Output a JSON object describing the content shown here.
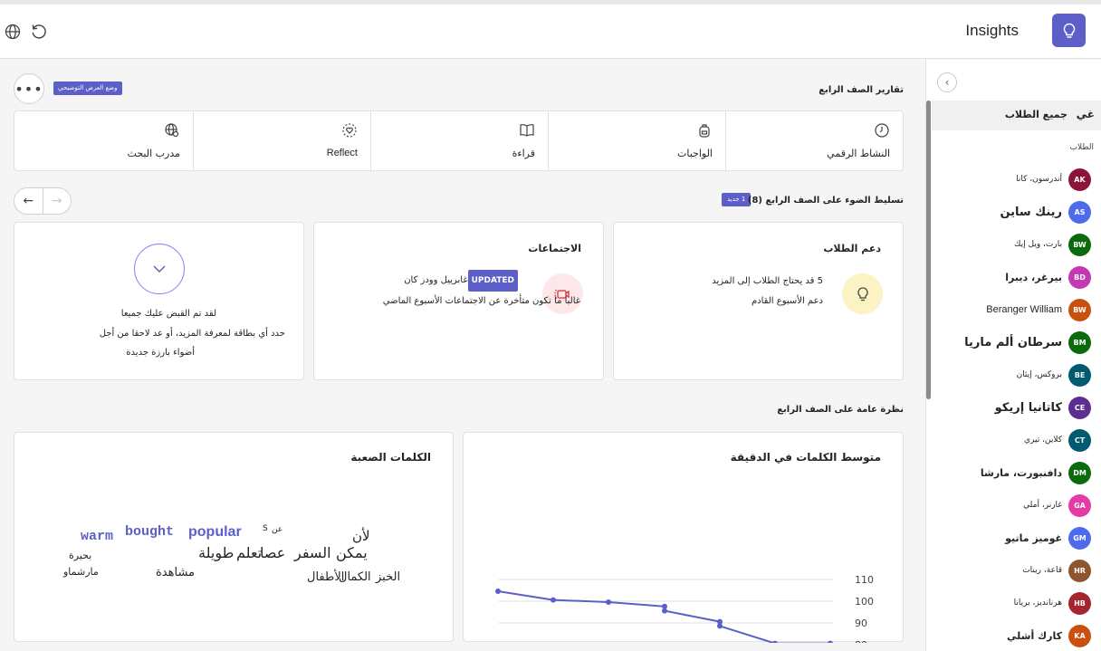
{
  "header": {
    "app_title": "Insights",
    "globe_icon": "globe-icon",
    "refresh_icon": "refresh-icon",
    "logo_icon": "lightbulb-icon"
  },
  "main": {
    "mode_badge": "وضع العرض التوضيحي",
    "reports_title": "تقارير الصف الرابع",
    "tabs": [
      {
        "label": "مدرب البحث",
        "icon": "globe-search-icon"
      },
      {
        "label": "Reflect",
        "icon": "heart-reflect-icon"
      },
      {
        "label": "قراءة",
        "icon": "book-icon"
      },
      {
        "label": "الواجبات",
        "icon": "backpack-icon"
      },
      {
        "label": "النشاط الرقمي",
        "icon": "clock-icon"
      }
    ],
    "spotlight_title": "تسليط الضوء على الصف الرابع (8)",
    "new_badge": "1 جديد",
    "cards": {
      "support": {
        "title": "دعم الطلاب",
        "line1": "5 قد يحتاج الطلاب إلى المزيد",
        "line2": "دعم الأسبوع القادم"
      },
      "meetings": {
        "title": "الاجتماعات",
        "badge": "UPDATED",
        "name": "غابرييل وودز كان",
        "line2": "غالبا ما تكون متأخرة عن الاجتماعات الأسبوع الماضي"
      },
      "caught_up": {
        "line1": "لقد تم القبض عليك جميعا",
        "line2": "حدد أي بطاقة لمعرفة المزيد، أو عد لاحقا من أجل",
        "line3": "أضواء بارزة جديدة"
      }
    },
    "overview_title": "نظرة عامة على الصف الرابع",
    "hard_words": {
      "title": "الكلمات الصعبة",
      "words": [
        {
          "text": "warm",
          "color": "#5b5fc7"
        },
        {
          "text": "bought",
          "color": "#5b5fc7"
        },
        {
          "text": "popular",
          "color": "#5b5fc7"
        },
        {
          "text": "عن",
          "color": "#242424"
        },
        {
          "text": "S",
          "color": "#242424"
        },
        {
          "text": "لأن",
          "color": "#242424"
        },
        {
          "text": "بحيرة",
          "color": "#242424"
        },
        {
          "text": "يمكن",
          "color": "#242424"
        },
        {
          "text": "السفر",
          "color": "#242424"
        },
        {
          "text": "عصا",
          "color": "#242424"
        },
        {
          "text": "تعلم",
          "color": "#242424"
        },
        {
          "text": "طويلة",
          "color": "#242424"
        },
        {
          "text": "مارشماو",
          "color": "#242424"
        },
        {
          "text": "مشاهدة",
          "color": "#242424"
        },
        {
          "text": "الخبز",
          "color": "#242424"
        },
        {
          "text": "الكمال",
          "color": "#242424"
        },
        {
          "text": "الأطفال",
          "color": "#242424"
        }
      ]
    }
  },
  "chart_data": {
    "type": "line",
    "title": "متوسط الكلمات في الدقيقة",
    "y_ticks": [
      "110",
      "100",
      "90",
      "80"
    ],
    "ylim": [
      80,
      110
    ],
    "values": [
      105,
      101,
      100,
      98,
      96,
      91,
      89,
      81,
      81
    ],
    "series_color": "#5b5fc7"
  },
  "sidebar": {
    "all_students_label": "جميع الطلاب",
    "all_students_icon": "غي",
    "students_label": "الطلاب",
    "students": [
      {
        "initials": "AK",
        "name": "أندرسون، كانا",
        "color": "#8b1538",
        "size": "small"
      },
      {
        "initials": "AS",
        "name": "رينك ساين",
        "color": "#4f6bed",
        "size": "large"
      },
      {
        "initials": "BW",
        "name": "بارت، ويل إيك",
        "color": "#0b6a0b",
        "size": "small"
      },
      {
        "initials": "BD",
        "name": "بيرغر، ديبرا",
        "color": "#c239b3",
        "size": "medium"
      },
      {
        "initials": "BW",
        "name": "Beranger William",
        "color": "#ca5010",
        "size": "medium"
      },
      {
        "initials": "BM",
        "name": "سرطان ألم ماريا",
        "color": "#0b6a0b",
        "size": "large"
      },
      {
        "initials": "BE",
        "name": "بروكس، إيثان",
        "color": "#005b70",
        "size": "small"
      },
      {
        "initials": "CE",
        "name": "كاتانيا إريكو",
        "color": "#5c2e91",
        "size": "large"
      },
      {
        "initials": "CT",
        "name": "كلاين، تيري",
        "color": "#005b70",
        "size": "small"
      },
      {
        "initials": "DM",
        "name": "دافنبورت، مارشا",
        "color": "#0b6a0b",
        "size": "medium"
      },
      {
        "initials": "GA",
        "name": "غارنر، أملي",
        "color": "#e43ba6",
        "size": "small"
      },
      {
        "initials": "GM",
        "name": "غوميز ماتيو",
        "color": "#4f6bed",
        "size": "medium"
      },
      {
        "initials": "HR",
        "name": "قاعة، رينات",
        "color": "#8e562e",
        "size": "small"
      },
      {
        "initials": "HB",
        "name": "هرنانديز، بريانا",
        "color": "#a4262c",
        "size": "small"
      },
      {
        "initials": "KA",
        "name": "كارك أشلي",
        "color": "#ca5010",
        "size": "medium"
      }
    ]
  }
}
